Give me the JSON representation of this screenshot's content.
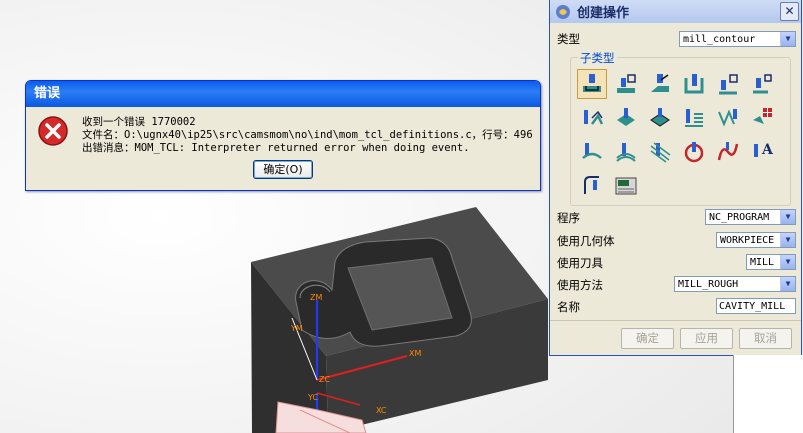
{
  "error_dialog": {
    "title": "错误",
    "line1": "收到一个错误 1770002",
    "line2": "文件名：O:\\ugnx40\\ip25\\src\\camsmom\\no\\ind\\mom_tcl_definitions.c，行号：496",
    "line3": "出错消息：MOM_TCL: Interpreter returned error when doing event.",
    "ok_label": "确定(O)"
  },
  "operation_dialog": {
    "title": "创建操作",
    "type_label": "类型",
    "type_value": "mill_contour",
    "subtype_label": "子类型",
    "subtype_icons": [
      "cavity-mill",
      "plunge-mill",
      "corner-rough",
      "rest-mill",
      "zlevel-profile",
      "zlevel-corner",
      "fixed-contour",
      "contour-area",
      "surface-area",
      "streamline",
      "contour-area-non-steep",
      "contour-area-dir-steep",
      "flowcut-single",
      "flowcut-multiple",
      "flowcut-ref-tool",
      "flowcut-smooth",
      "profile-3d",
      "contour-text",
      "generic-motion",
      "mill-control"
    ],
    "program_label": "程序",
    "program_value": "NC_PROGRAM",
    "geometry_label": "使用几何体",
    "geometry_value": "WORKPIECE",
    "tool_label": "使用刀具",
    "tool_value": "MILL",
    "method_label": "使用方法",
    "method_value": "MILL_ROUGH",
    "name_label": "名称",
    "name_value": "CAVITY_MILL",
    "ok_label": "确定",
    "apply_label": "应用",
    "cancel_label": "取消"
  },
  "viewport": {
    "axis_zm": "ZM",
    "axis_ym": "YM",
    "axis_xm": "XM",
    "axis_zc": "ZC",
    "axis_yc": "YC",
    "axis_xc": "XC"
  },
  "colors": {
    "accent": "#0a5ce8",
    "error": "#c4262b"
  }
}
